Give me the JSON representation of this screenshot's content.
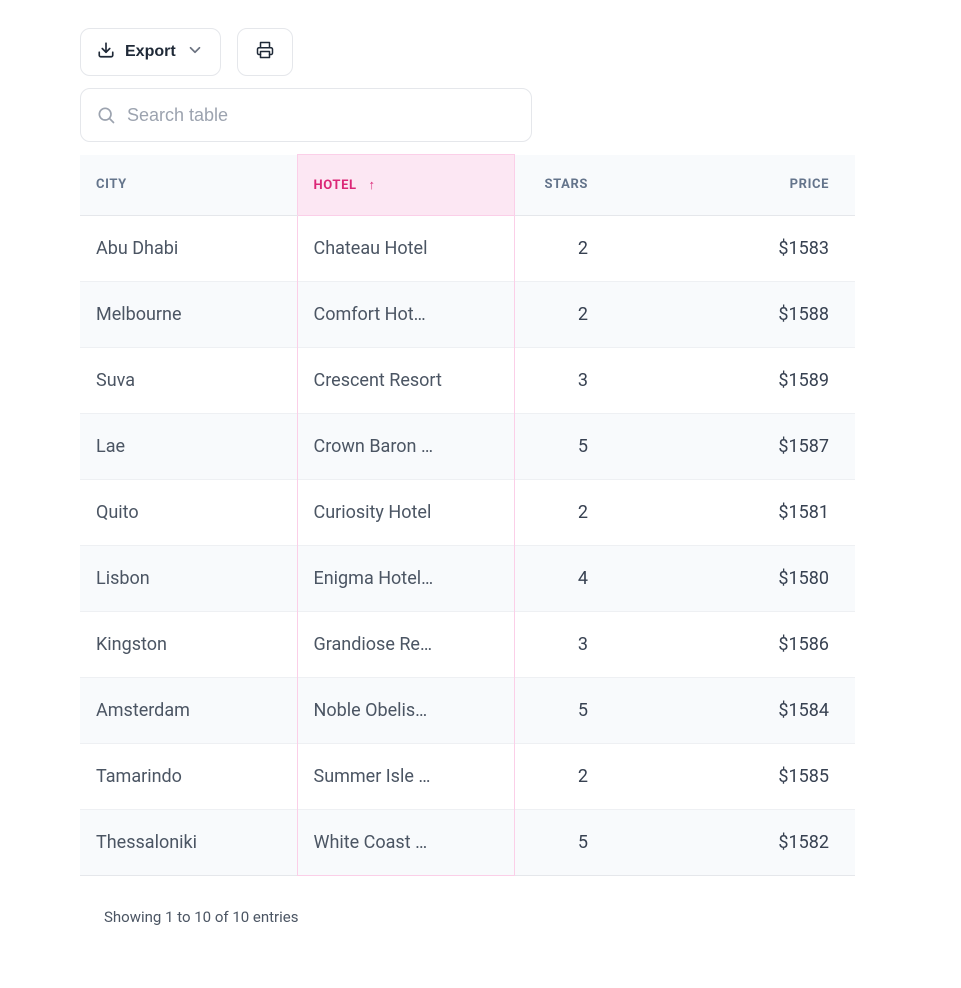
{
  "toolbar": {
    "export_label": "Export"
  },
  "search": {
    "placeholder": "Search table"
  },
  "columns": {
    "city": "CITY",
    "hotel": "HOTEL",
    "stars": "STARS",
    "price": "PRICE"
  },
  "rows": [
    {
      "city": "Abu Dhabi",
      "hotel": "Chateau Hotel",
      "stars": "2",
      "price": "$1583"
    },
    {
      "city": "Melbourne",
      "hotel": "Comfort Hot…",
      "stars": "2",
      "price": "$1588"
    },
    {
      "city": "Suva",
      "hotel": "Crescent Resort",
      "stars": "3",
      "price": "$1589"
    },
    {
      "city": "Lae",
      "hotel": "Crown Baron …",
      "stars": "5",
      "price": "$1587"
    },
    {
      "city": "Quito",
      "hotel": "Curiosity Hotel",
      "stars": "2",
      "price": "$1581"
    },
    {
      "city": "Lisbon",
      "hotel": "Enigma Hotel…",
      "stars": "4",
      "price": "$1580"
    },
    {
      "city": "Kingston",
      "hotel": "Grandiose Re…",
      "stars": "3",
      "price": "$1586"
    },
    {
      "city": "Amsterdam",
      "hotel": "Noble Obelis…",
      "stars": "5",
      "price": "$1584"
    },
    {
      "city": "Tamarindo",
      "hotel": "Summer Isle …",
      "stars": "2",
      "price": "$1585"
    },
    {
      "city": "Thessaloniki",
      "hotel": "White Coast …",
      "stars": "5",
      "price": "$1582"
    }
  ],
  "footer": {
    "info": "Showing 1 to 10 of 10 entries"
  }
}
